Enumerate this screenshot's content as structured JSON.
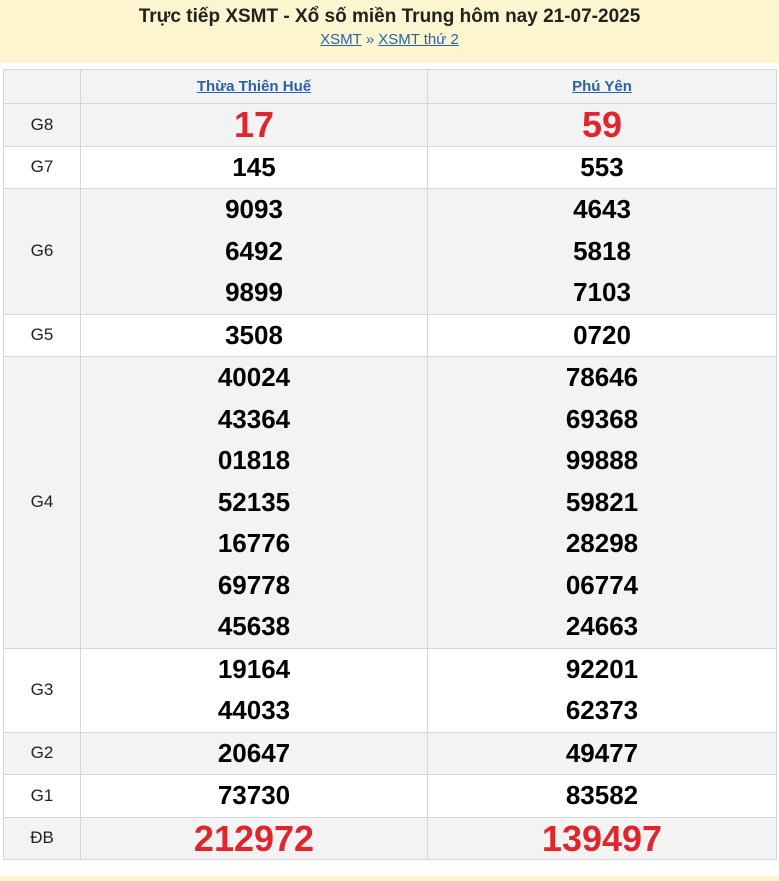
{
  "header": {
    "title": "Trực tiếp XSMT - Xổ số miền Trung hôm nay 21-07-2025",
    "crumbs": [
      "XSMT",
      "XSMT thứ 2"
    ],
    "separator": "»"
  },
  "provinces": [
    "Thừa Thiên Huế",
    "Phú Yên"
  ],
  "colors": {
    "accent_red": "#e0262d",
    "link_blue": "#2a62a8",
    "header_bg": "#fdf5cf"
  },
  "prizes": [
    {
      "label": "G8",
      "values": [
        [
          "17"
        ],
        [
          "59"
        ]
      ]
    },
    {
      "label": "G7",
      "values": [
        [
          "145"
        ],
        [
          "553"
        ]
      ]
    },
    {
      "label": "G6",
      "values": [
        [
          "9093",
          "6492",
          "9899"
        ],
        [
          "4643",
          "5818",
          "7103"
        ]
      ]
    },
    {
      "label": "G5",
      "values": [
        [
          "3508"
        ],
        [
          "0720"
        ]
      ]
    },
    {
      "label": "G4",
      "values": [
        [
          "40024",
          "43364",
          "01818",
          "52135",
          "16776",
          "69778",
          "45638"
        ],
        [
          "78646",
          "69368",
          "99888",
          "59821",
          "28298",
          "06774",
          "24663"
        ]
      ]
    },
    {
      "label": "G3",
      "values": [
        [
          "19164",
          "44033"
        ],
        [
          "92201",
          "62373"
        ]
      ]
    },
    {
      "label": "G2",
      "values": [
        [
          "20647"
        ],
        [
          "49477"
        ]
      ]
    },
    {
      "label": "G1",
      "values": [
        [
          "73730"
        ],
        [
          "83582"
        ]
      ]
    },
    {
      "label": "ĐB",
      "values": [
        [
          "212972"
        ],
        [
          "139497"
        ]
      ]
    }
  ]
}
